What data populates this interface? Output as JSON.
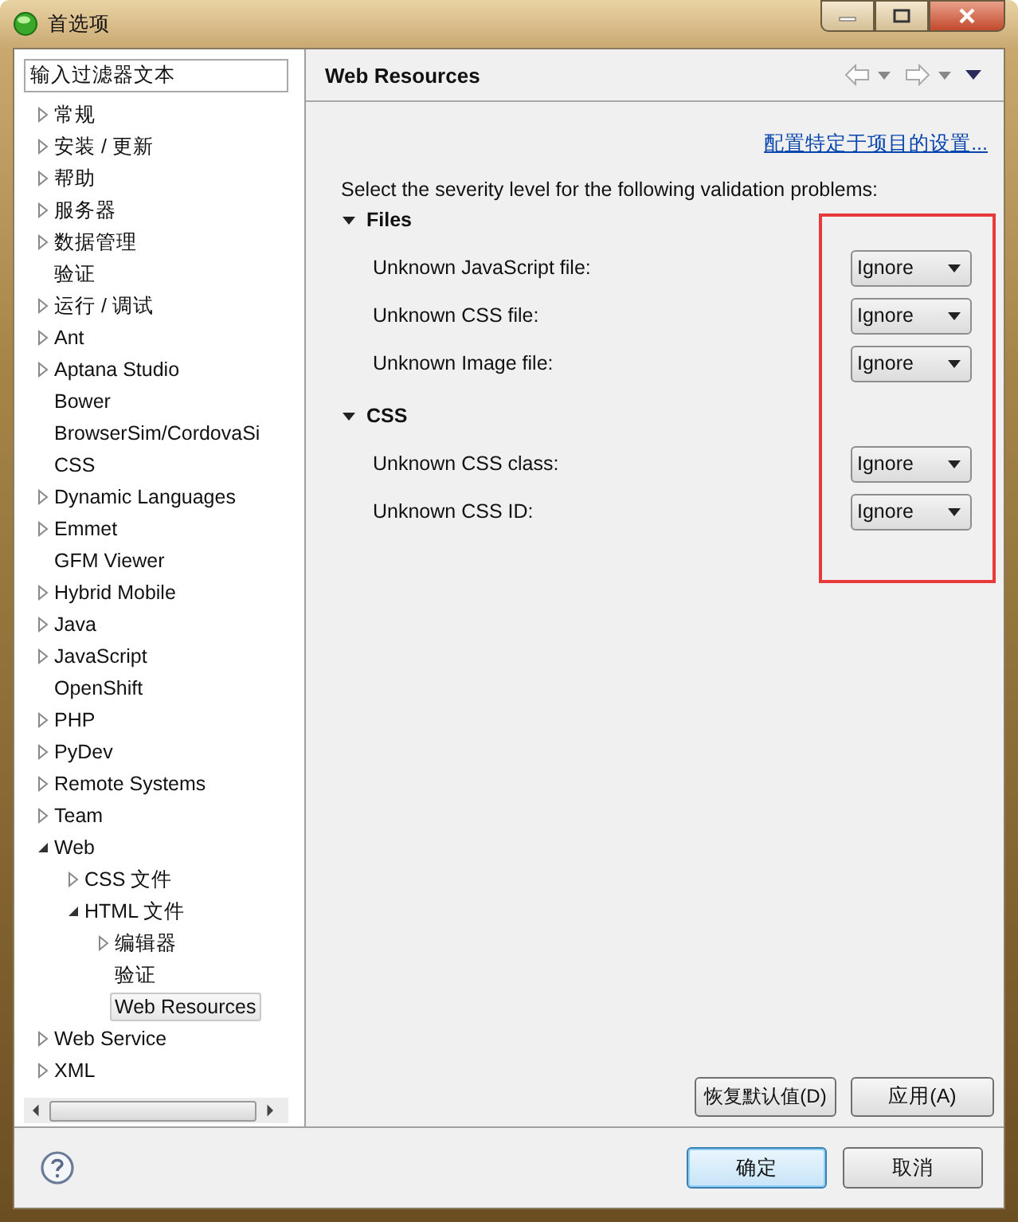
{
  "window": {
    "title": "首选项"
  },
  "filter": {
    "value": "输入过滤器文本"
  },
  "tree": [
    {
      "label": "常规",
      "kind": "branch",
      "expanded": false,
      "selected": false
    },
    {
      "label": "安装 / 更新",
      "kind": "branch",
      "expanded": false,
      "selected": false
    },
    {
      "label": "帮助",
      "kind": "branch",
      "expanded": false,
      "selected": false
    },
    {
      "label": "服务器",
      "kind": "branch",
      "expanded": false,
      "selected": false
    },
    {
      "label": "数据管理",
      "kind": "branch",
      "expanded": false,
      "selected": false
    },
    {
      "label": "验证",
      "kind": "leaf",
      "selected": false
    },
    {
      "label": "运行 / 调试",
      "kind": "branch",
      "expanded": false,
      "selected": false
    },
    {
      "label": "Ant",
      "kind": "branch",
      "expanded": false,
      "selected": false
    },
    {
      "label": "Aptana Studio",
      "kind": "branch",
      "expanded": false,
      "selected": false
    },
    {
      "label": "Bower",
      "kind": "leaf",
      "selected": false
    },
    {
      "label": "BrowserSim/CordovaSi",
      "kind": "leaf",
      "selected": false
    },
    {
      "label": "CSS",
      "kind": "leaf",
      "selected": false
    },
    {
      "label": "Dynamic Languages",
      "kind": "branch",
      "expanded": false,
      "selected": false
    },
    {
      "label": "Emmet",
      "kind": "branch",
      "expanded": false,
      "selected": false
    },
    {
      "label": "GFM Viewer",
      "kind": "leaf",
      "selected": false
    },
    {
      "label": "Hybrid Mobile",
      "kind": "branch",
      "expanded": false,
      "selected": false
    },
    {
      "label": "Java",
      "kind": "branch",
      "expanded": false,
      "selected": false
    },
    {
      "label": "JavaScript",
      "kind": "branch",
      "expanded": false,
      "selected": false
    },
    {
      "label": "OpenShift",
      "kind": "leaf",
      "selected": false
    },
    {
      "label": "PHP",
      "kind": "branch",
      "expanded": false,
      "selected": false
    },
    {
      "label": "PyDev",
      "kind": "branch",
      "expanded": false,
      "selected": false
    },
    {
      "label": "Remote Systems",
      "kind": "branch",
      "expanded": false,
      "selected": false
    },
    {
      "label": "Team",
      "kind": "branch",
      "expanded": false,
      "selected": false
    },
    {
      "label": "Web",
      "kind": "branch",
      "expanded": true,
      "selected": false,
      "children": [
        {
          "label": "CSS 文件",
          "kind": "branch",
          "expanded": false,
          "selected": false
        },
        {
          "label": "HTML 文件",
          "kind": "branch",
          "expanded": true,
          "selected": false,
          "children": [
            {
              "label": "编辑器",
              "kind": "branch",
              "expanded": false,
              "selected": false
            },
            {
              "label": "验证",
              "kind": "leaf",
              "selected": false
            },
            {
              "label": "Web Resources",
              "kind": "leaf",
              "selected": true
            }
          ]
        }
      ]
    },
    {
      "label": "Web Service",
      "kind": "branch",
      "expanded": false,
      "selected": false
    },
    {
      "label": "XML",
      "kind": "branch",
      "expanded": false,
      "selected": false
    }
  ],
  "page": {
    "title": "Web Resources",
    "link": "配置特定于项目的设置...",
    "description": "Select the severity level for the following validation problems:",
    "sections": [
      {
        "title": "Files",
        "expanded": true,
        "rows": [
          {
            "label": "Unknown JavaScript file:",
            "value": "Ignore"
          },
          {
            "label": "Unknown CSS file:",
            "value": "Ignore"
          },
          {
            "label": "Unknown Image file:",
            "value": "Ignore"
          }
        ]
      },
      {
        "title": "CSS",
        "expanded": true,
        "rows": [
          {
            "label": "Unknown CSS class:",
            "value": "Ignore"
          },
          {
            "label": "Unknown CSS ID:",
            "value": "Ignore"
          }
        ]
      }
    ],
    "buttons": [
      "恢复默认值(D)",
      "应用(A)"
    ]
  },
  "highlight": {
    "shown": true,
    "color": "#e83a3a"
  },
  "dialog_buttons": [
    {
      "label": "确定",
      "default": true
    },
    {
      "label": "取消",
      "default": false
    }
  ]
}
